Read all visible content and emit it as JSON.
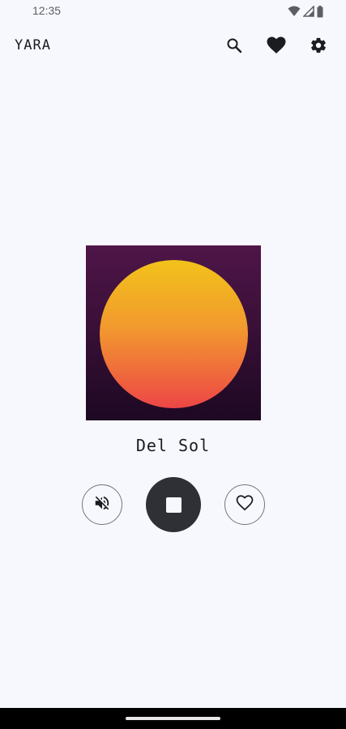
{
  "status_bar": {
    "time": "12:35",
    "icons": [
      "wifi-icon",
      "signal-icon",
      "battery-icon"
    ]
  },
  "app_bar": {
    "title": "YARA",
    "actions": [
      "search-icon",
      "heart-icon",
      "gear-icon"
    ]
  },
  "player": {
    "track_title": "Del Sol",
    "controls": {
      "mute": "volume-off-icon",
      "stop": "stop-icon",
      "favorite": "heart-outline-icon"
    }
  },
  "colors": {
    "background": "#f7f8fd",
    "stop_button": "#2e3035",
    "artwork_bg_top": "#4f1548",
    "artwork_bg_bottom": "#1d0822",
    "sun_top": "#f2c21a",
    "sun_bottom": "#ec4646"
  }
}
